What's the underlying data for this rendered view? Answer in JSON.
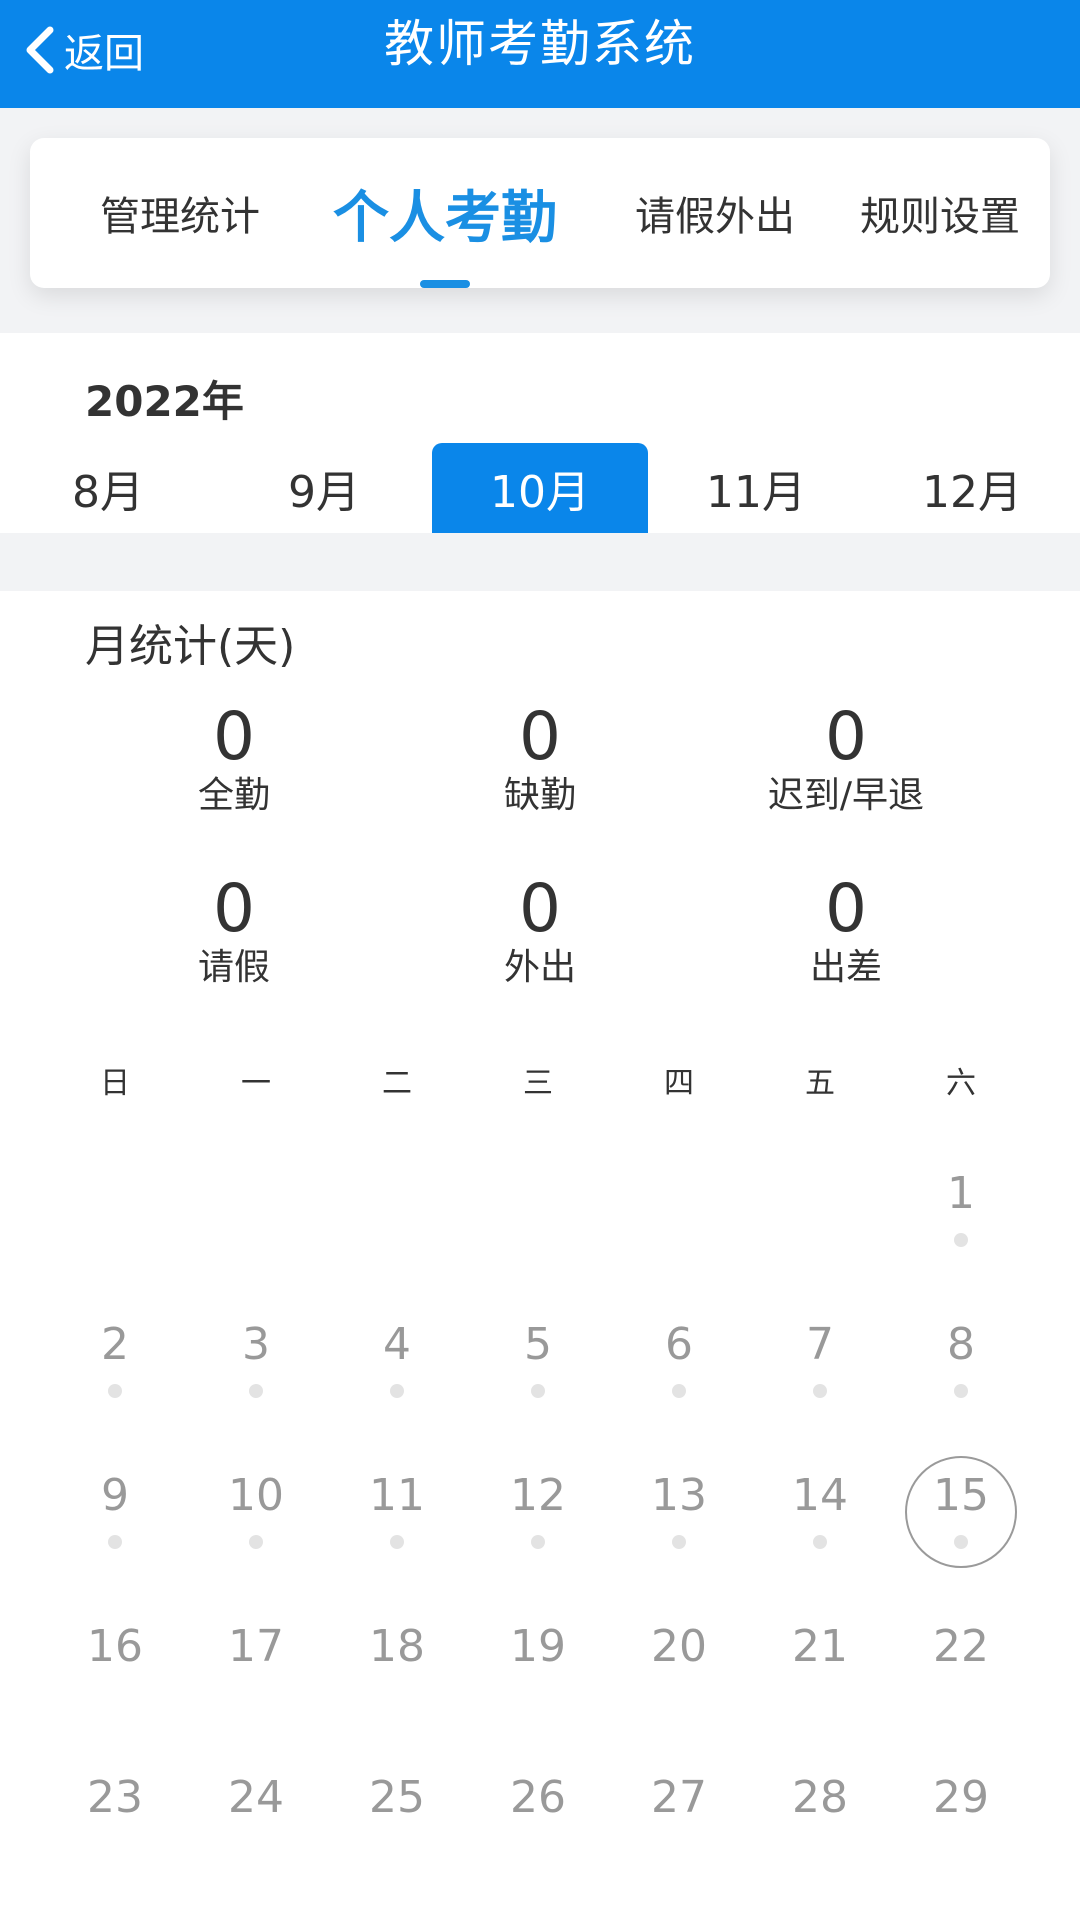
{
  "header": {
    "back_label": "返回",
    "title": "教师考勤系统",
    "color": "#0a86ea"
  },
  "tabs": [
    {
      "label": "管理统计",
      "active": false
    },
    {
      "label": "个人考勤",
      "active": true
    },
    {
      "label": "请假外出",
      "active": false
    },
    {
      "label": "规则设置",
      "active": false
    }
  ],
  "calendar_header": {
    "year": "2022年",
    "months": [
      {
        "label": "8月",
        "active": false
      },
      {
        "label": "9月",
        "active": false
      },
      {
        "label": "10月",
        "active": true
      },
      {
        "label": "11月",
        "active": false
      },
      {
        "label": "12月",
        "active": false
      }
    ]
  },
  "monthly_stats": {
    "title": "月统计(天)",
    "items": [
      {
        "value": "0",
        "label": "全勤"
      },
      {
        "value": "0",
        "label": "缺勤"
      },
      {
        "value": "0",
        "label": "迟到/早退"
      },
      {
        "value": "0",
        "label": "请假"
      },
      {
        "value": "0",
        "label": "外出"
      },
      {
        "value": "0",
        "label": "出差"
      }
    ]
  },
  "calendar": {
    "weekdays": [
      "日",
      "一",
      "二",
      "三",
      "四",
      "五",
      "六"
    ],
    "first_weekday_index": 6,
    "days": [
      "1",
      "2",
      "3",
      "4",
      "5",
      "6",
      "7",
      "8",
      "9",
      "10",
      "11",
      "12",
      "13",
      "14",
      "15",
      "16",
      "17",
      "18",
      "19",
      "20",
      "21",
      "22",
      "23",
      "24",
      "25",
      "26",
      "27",
      "28",
      "29"
    ],
    "today": "15",
    "days_with_dot": [
      "1",
      "2",
      "3",
      "4",
      "5",
      "6",
      "7",
      "8",
      "9",
      "10",
      "11",
      "12",
      "13",
      "14",
      "15"
    ]
  }
}
